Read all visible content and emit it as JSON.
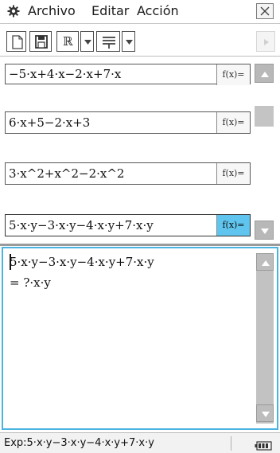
{
  "menubar": {
    "settings_icon": "gear-icon",
    "items": [
      "Archivo",
      "Editar",
      "Acción"
    ],
    "close_icon": "close-icon"
  },
  "toolbar": {
    "buttons": [
      "new-document-icon",
      "save-icon",
      "real-mode-icon",
      "dropdown-arrow-icon",
      "fraction-format-icon",
      "dropdown-arrow-icon"
    ],
    "real_label": "ℝ",
    "right_icon": "play-right-icon"
  },
  "history": {
    "entries": [
      {
        "expr": "−5·x+4·x−2·x+7·x",
        "button": "f(x)=",
        "active": false
      },
      {
        "expr": "6·x+5−2·x+3",
        "button": "f(x)=",
        "active": false
      },
      {
        "expr": "3·x^2+x^2−2·x^2",
        "button": "f(x)=",
        "active": false
      },
      {
        "expr": "5·x·y−3·x·y−4·x·y+7·x·y",
        "button": "f(x)=",
        "active": true
      }
    ]
  },
  "work": {
    "input": "5·x·y−3·x·y−4·x·y+7·x·y",
    "result": "= ?·x·y"
  },
  "status": {
    "text": "Exp:5·x·y−3·x·y−4·x·y+7·x·y",
    "battery_icon": "battery-icon"
  },
  "colors": {
    "active_button": "#5fc5ee",
    "work_border": "#4ab3e0",
    "scrollbar": "#c2c2c2"
  }
}
